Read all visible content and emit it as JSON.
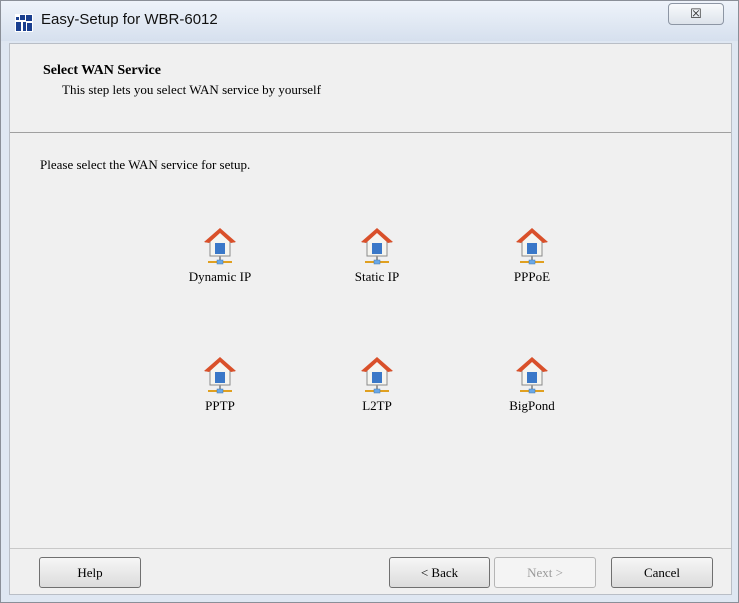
{
  "window": {
    "title": "Easy-Setup for WBR-6012",
    "close_glyph": "☒"
  },
  "header": {
    "title": "Select WAN Service",
    "subtitle": "This step lets you select WAN service by yourself"
  },
  "prompt": "Please select the WAN service for setup.",
  "services": [
    {
      "label": "Dynamic IP",
      "icon": "house-network-icon"
    },
    {
      "label": "Static IP",
      "icon": "house-network-icon"
    },
    {
      "label": "PPPoE",
      "icon": "house-network-icon"
    },
    {
      "label": "PPTP",
      "icon": "house-network-icon"
    },
    {
      "label": "L2TP",
      "icon": "house-network-icon"
    },
    {
      "label": "BigPond",
      "icon": "house-network-icon"
    }
  ],
  "buttons": {
    "help": "Help",
    "back": "< Back",
    "next": "Next >",
    "cancel": "Cancel"
  },
  "colors": {
    "roof": "#d9502a",
    "house_body": "#f5f5f0",
    "window_blue": "#3a78c8",
    "cable": "#e0a020"
  }
}
